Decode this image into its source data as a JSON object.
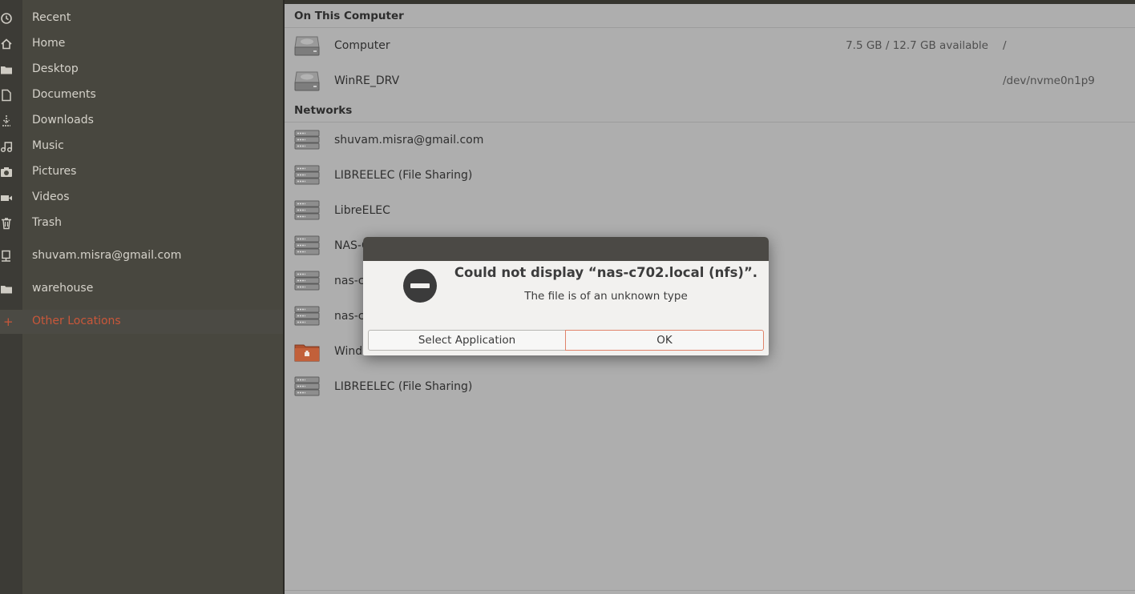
{
  "sidebar": {
    "items": [
      {
        "label": "Recent",
        "icon": "clock-icon"
      },
      {
        "label": "Home",
        "icon": "home-icon"
      },
      {
        "label": "Desktop",
        "icon": "folder-icon"
      },
      {
        "label": "Documents",
        "icon": "document-icon"
      },
      {
        "label": "Downloads",
        "icon": "download-icon"
      },
      {
        "label": "Music",
        "icon": "music-icon"
      },
      {
        "label": "Pictures",
        "icon": "camera-icon"
      },
      {
        "label": "Videos",
        "icon": "video-icon"
      },
      {
        "label": "Trash",
        "icon": "trash-icon"
      },
      {
        "label": "shuvam.misra@gmail.com",
        "icon": "network-drive-icon"
      },
      {
        "label": "warehouse",
        "icon": "folder-icon"
      },
      {
        "label": "Other Locations",
        "icon": "plus-icon"
      }
    ],
    "active_color": "#c9573a"
  },
  "main": {
    "on_this_computer": {
      "header": "On This Computer",
      "items": [
        {
          "name": "Computer",
          "space": "7.5 GB / 12.7 GB available",
          "path": "/"
        },
        {
          "name": "WinRE_DRV",
          "space": "",
          "path": "/dev/nvme0n1p9"
        }
      ]
    },
    "networks": {
      "header": "Networks",
      "items": [
        {
          "name": "shuvam.misra@gmail.com"
        },
        {
          "name": "LIBREELEC (File Sharing)"
        },
        {
          "name": "LibreELEC"
        },
        {
          "name": "NAS-C"
        },
        {
          "name": "nas-c"
        },
        {
          "name": "nas-c"
        },
        {
          "name": "Wind"
        },
        {
          "name": "LIBREELEC (File Sharing)"
        }
      ]
    }
  },
  "dialog": {
    "title": "Could not display “nas-c702.local (nfs)”.",
    "message": "The file is of an unknown type",
    "select_application_label": "Select Application",
    "ok_label": "OK",
    "icon": "stop-icon"
  }
}
